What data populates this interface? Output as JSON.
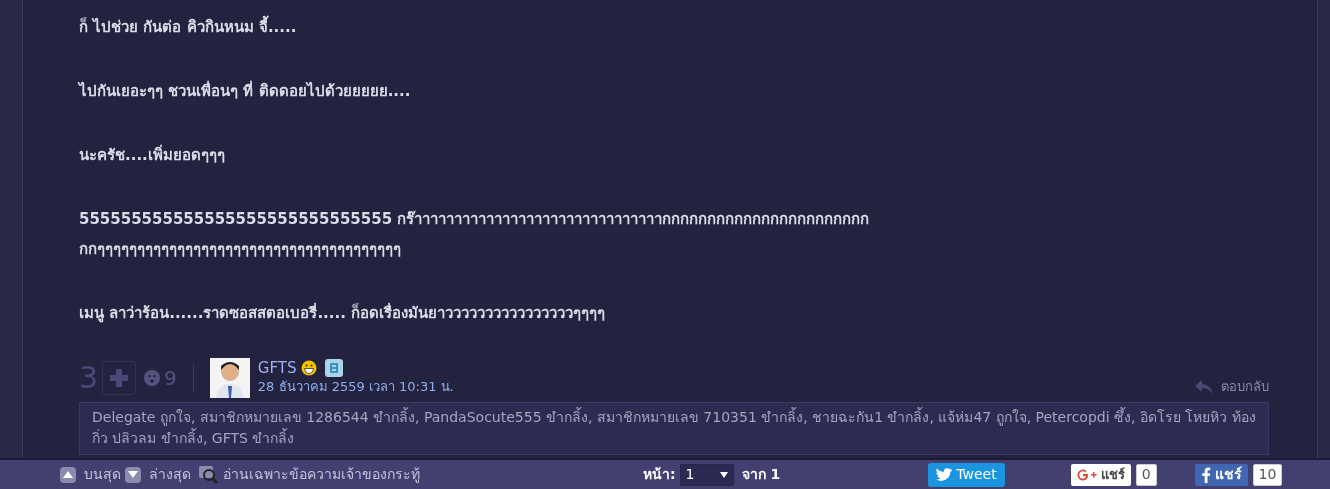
{
  "post": {
    "paragraphs": [
      {
        "lines": [
          "ก็ ไปช่วย กันต่อ คิวกินหนม จี้....."
        ]
      },
      {
        "lines": [
          "ไปกันเยอะๆๆ ชวนเพื่อนๆ ที่ ติดดอยไปด้วยยยยย...."
        ]
      },
      {
        "lines": [
          "นะครัช....เพิ่มยอดๆๆๆ"
        ]
      },
      {
        "lines": [
          "555555555555555555555555555555 กร๊าาาาาาาาาาาาาาาาาาาาาาาาาาาาาาากกกกกกกกกกกกกกกกกกกกกกก",
          "กกๆๆๆๆๆๆๆๆๆๆๆๆๆๆๆๆๆๆๆๆๆๆๆๆๆๆๆๆๆๆๆๆๆๆๆๆๆๆ"
        ]
      },
      {
        "lines": [
          "เมนู ลาว่าร้อน......ราดซอสสตอเบอรี่..... ก็อดเรื่องมันยาววววววววววววววววๆๆๆๆ"
        ]
      }
    ]
  },
  "comment": {
    "score": "3",
    "reaction_count": "9",
    "author": "GFTS",
    "date": "28 ธันวาคม 2559 เวลา 10:31 น.",
    "reply": "ตอบกลับ",
    "reactions": "Delegate ถูกใจ, สมาชิกหมายเลข 1286544 ขำกลิ้ง, PandaSocute555 ขำกลิ้ง, สมาชิกหมายเลข 710351 ขำกลิ้ง, ชายฉะกัน1 ขำกลิ้ง, แจ้ห่ม47 ถูกใจ, Petercopdi ซึ้ง, อิดโรย โหยหิว ท้องกิ่ว ปลิวลม ขำกลิ้ง, GFTS ขำกลิ้ง"
  },
  "footer": {
    "top": "บนสุด",
    "bottom": "ล่างสุด",
    "owner_only": "อ่านเฉพาะข้อความเจ้าของกระทู้",
    "page_label": "หน้า:",
    "page": "1",
    "page_total": "จาก 1",
    "tweet": "Tweet",
    "gplus_share": "แชร์",
    "gplus_count": "0",
    "fb_share": "แชร์",
    "fb_count": "10"
  }
}
